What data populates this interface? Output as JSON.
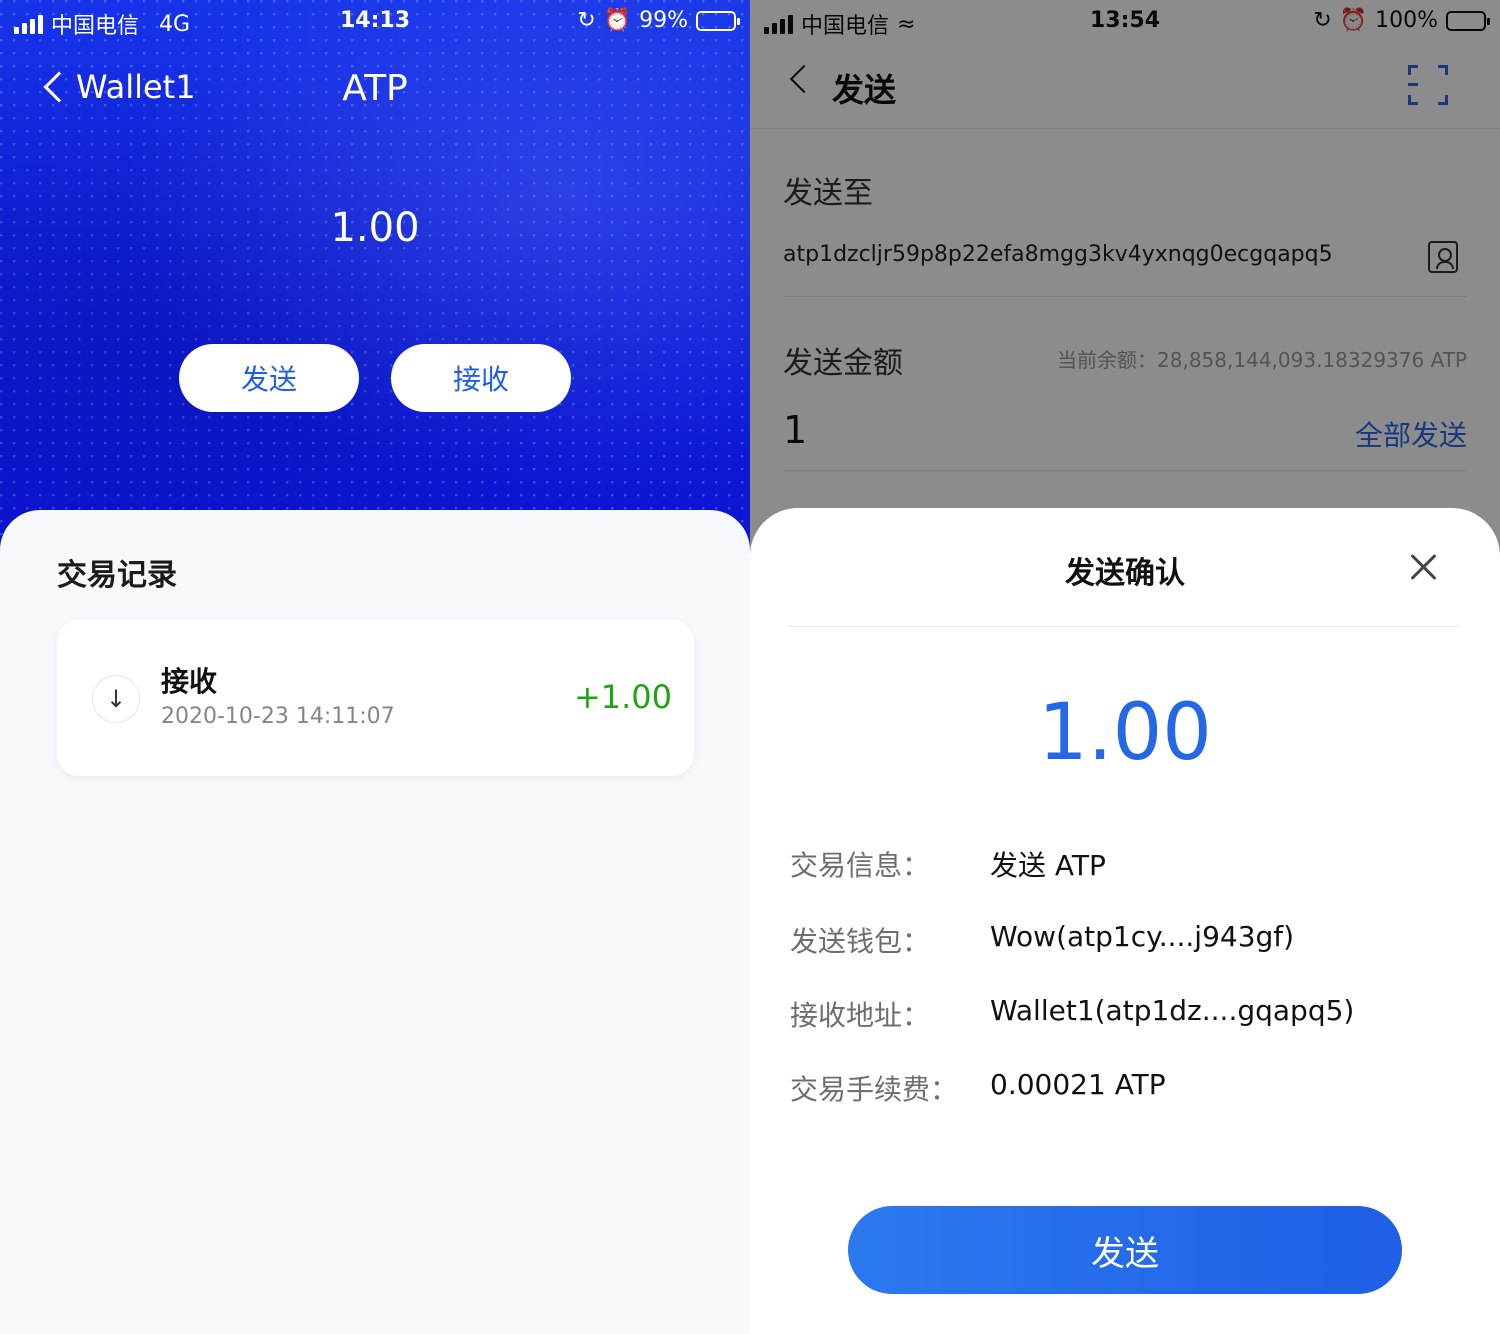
{
  "left": {
    "statusbar": {
      "carrier": "中国电信",
      "network": "4G",
      "time": "14:13",
      "battery": "99%"
    },
    "nav": {
      "back_label": "Wallet1",
      "title": "ATP"
    },
    "balance": "1.00",
    "buttons": {
      "send": "发送",
      "receive": "接收"
    },
    "records": {
      "title": "交易记录",
      "items": [
        {
          "type": "接收",
          "date": "2020-10-23 14:11:07",
          "amount": "+1.00"
        }
      ]
    }
  },
  "right": {
    "statusbar": {
      "carrier": "中国电信",
      "time": "13:54",
      "battery": "100%"
    },
    "nav": {
      "title": "发送"
    },
    "form": {
      "to_label": "发送至",
      "address": "atp1dzcljr59p8p22efa8mgg3kv4yxnqg0ecgqapq5",
      "amount_label": "发送金额",
      "balance_note": "当前余额：28,858,144,093.18329376 ATP",
      "amount": "1",
      "send_all": "全部发送"
    },
    "sheet": {
      "title": "发送确认",
      "amount": "1.00",
      "rows": [
        {
          "key": "交易信息：",
          "value": "发送 ATP"
        },
        {
          "key": "发送钱包：",
          "value": "Wow(atp1cy....j943gf)"
        },
        {
          "key": "接收地址：",
          "value": "Wallet1(atp1dz....gqapq5)"
        },
        {
          "key": "交易手续费：",
          "value": "0.00021 ATP"
        }
      ],
      "button": "发送"
    }
  },
  "colors": {
    "hero_blue": "#1022dc",
    "accent_blue": "#2468e8",
    "positive_green": "#21a418"
  }
}
